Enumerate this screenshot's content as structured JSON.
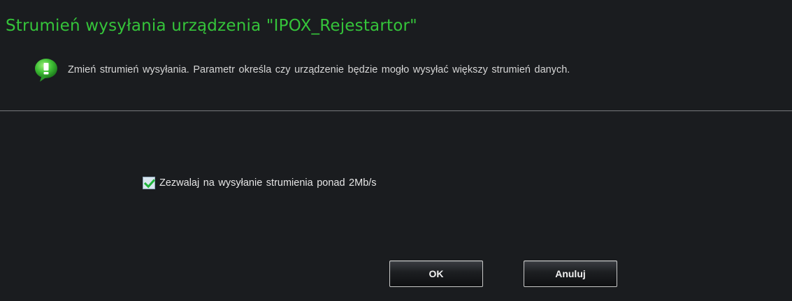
{
  "dialog": {
    "title": "Strumień wysyłania urządzenia \"IPOX_Rejestartor\"",
    "info_text": "Zmień strumień wysyłania. Parametr określa czy urządzenie będzie mogło wysyłać większy strumień danych.",
    "info_icon": "info-bubble-icon",
    "checkbox": {
      "label": "Zezwalaj na wysyłanie strumienia ponad 2Mb/s",
      "checked": true
    },
    "buttons": {
      "ok_label": "OK",
      "cancel_label": "Anuluj"
    }
  },
  "colors": {
    "title": "#35c43a",
    "background": "#1a1c1f",
    "icon_green": "#44c23f"
  }
}
